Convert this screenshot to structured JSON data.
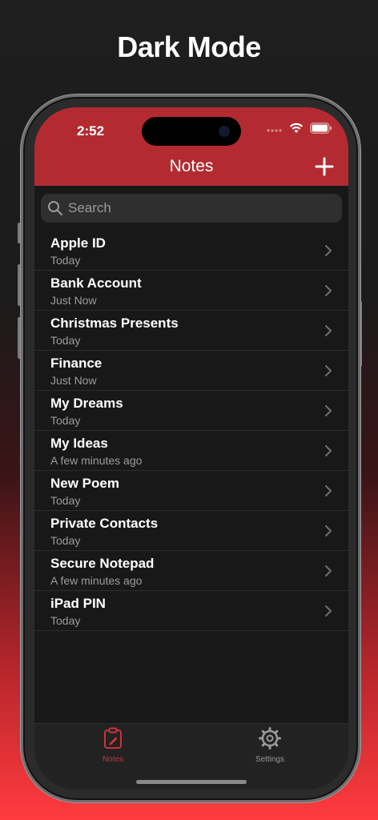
{
  "headline": "Dark Mode",
  "status": {
    "time": "2:52"
  },
  "nav": {
    "title": "Notes",
    "add_icon": "plus-icon"
  },
  "search": {
    "placeholder": "Search"
  },
  "notes": [
    {
      "title": "Apple ID",
      "date": "Today"
    },
    {
      "title": "Bank Account",
      "date": "Just Now"
    },
    {
      "title": "Christmas Presents",
      "date": "Today"
    },
    {
      "title": "Finance",
      "date": "Just Now"
    },
    {
      "title": "My Dreams",
      "date": "Today"
    },
    {
      "title": "My Ideas",
      "date": "A few minutes ago"
    },
    {
      "title": "New Poem",
      "date": "Today"
    },
    {
      "title": "Private Contacts",
      "date": "Today"
    },
    {
      "title": "Secure Notepad",
      "date": "A few minutes ago"
    },
    {
      "title": "iPad PIN",
      "date": "Today"
    }
  ],
  "tabs": [
    {
      "label": "Notes",
      "icon": "notes-clipboard-icon",
      "active": true
    },
    {
      "label": "Settings",
      "icon": "gear-icon",
      "active": false
    }
  ],
  "colors": {
    "accent": "#b32b30",
    "active_tab": "#c8353a",
    "inactive_tab": "#9a9a9a",
    "background": "#181818"
  }
}
